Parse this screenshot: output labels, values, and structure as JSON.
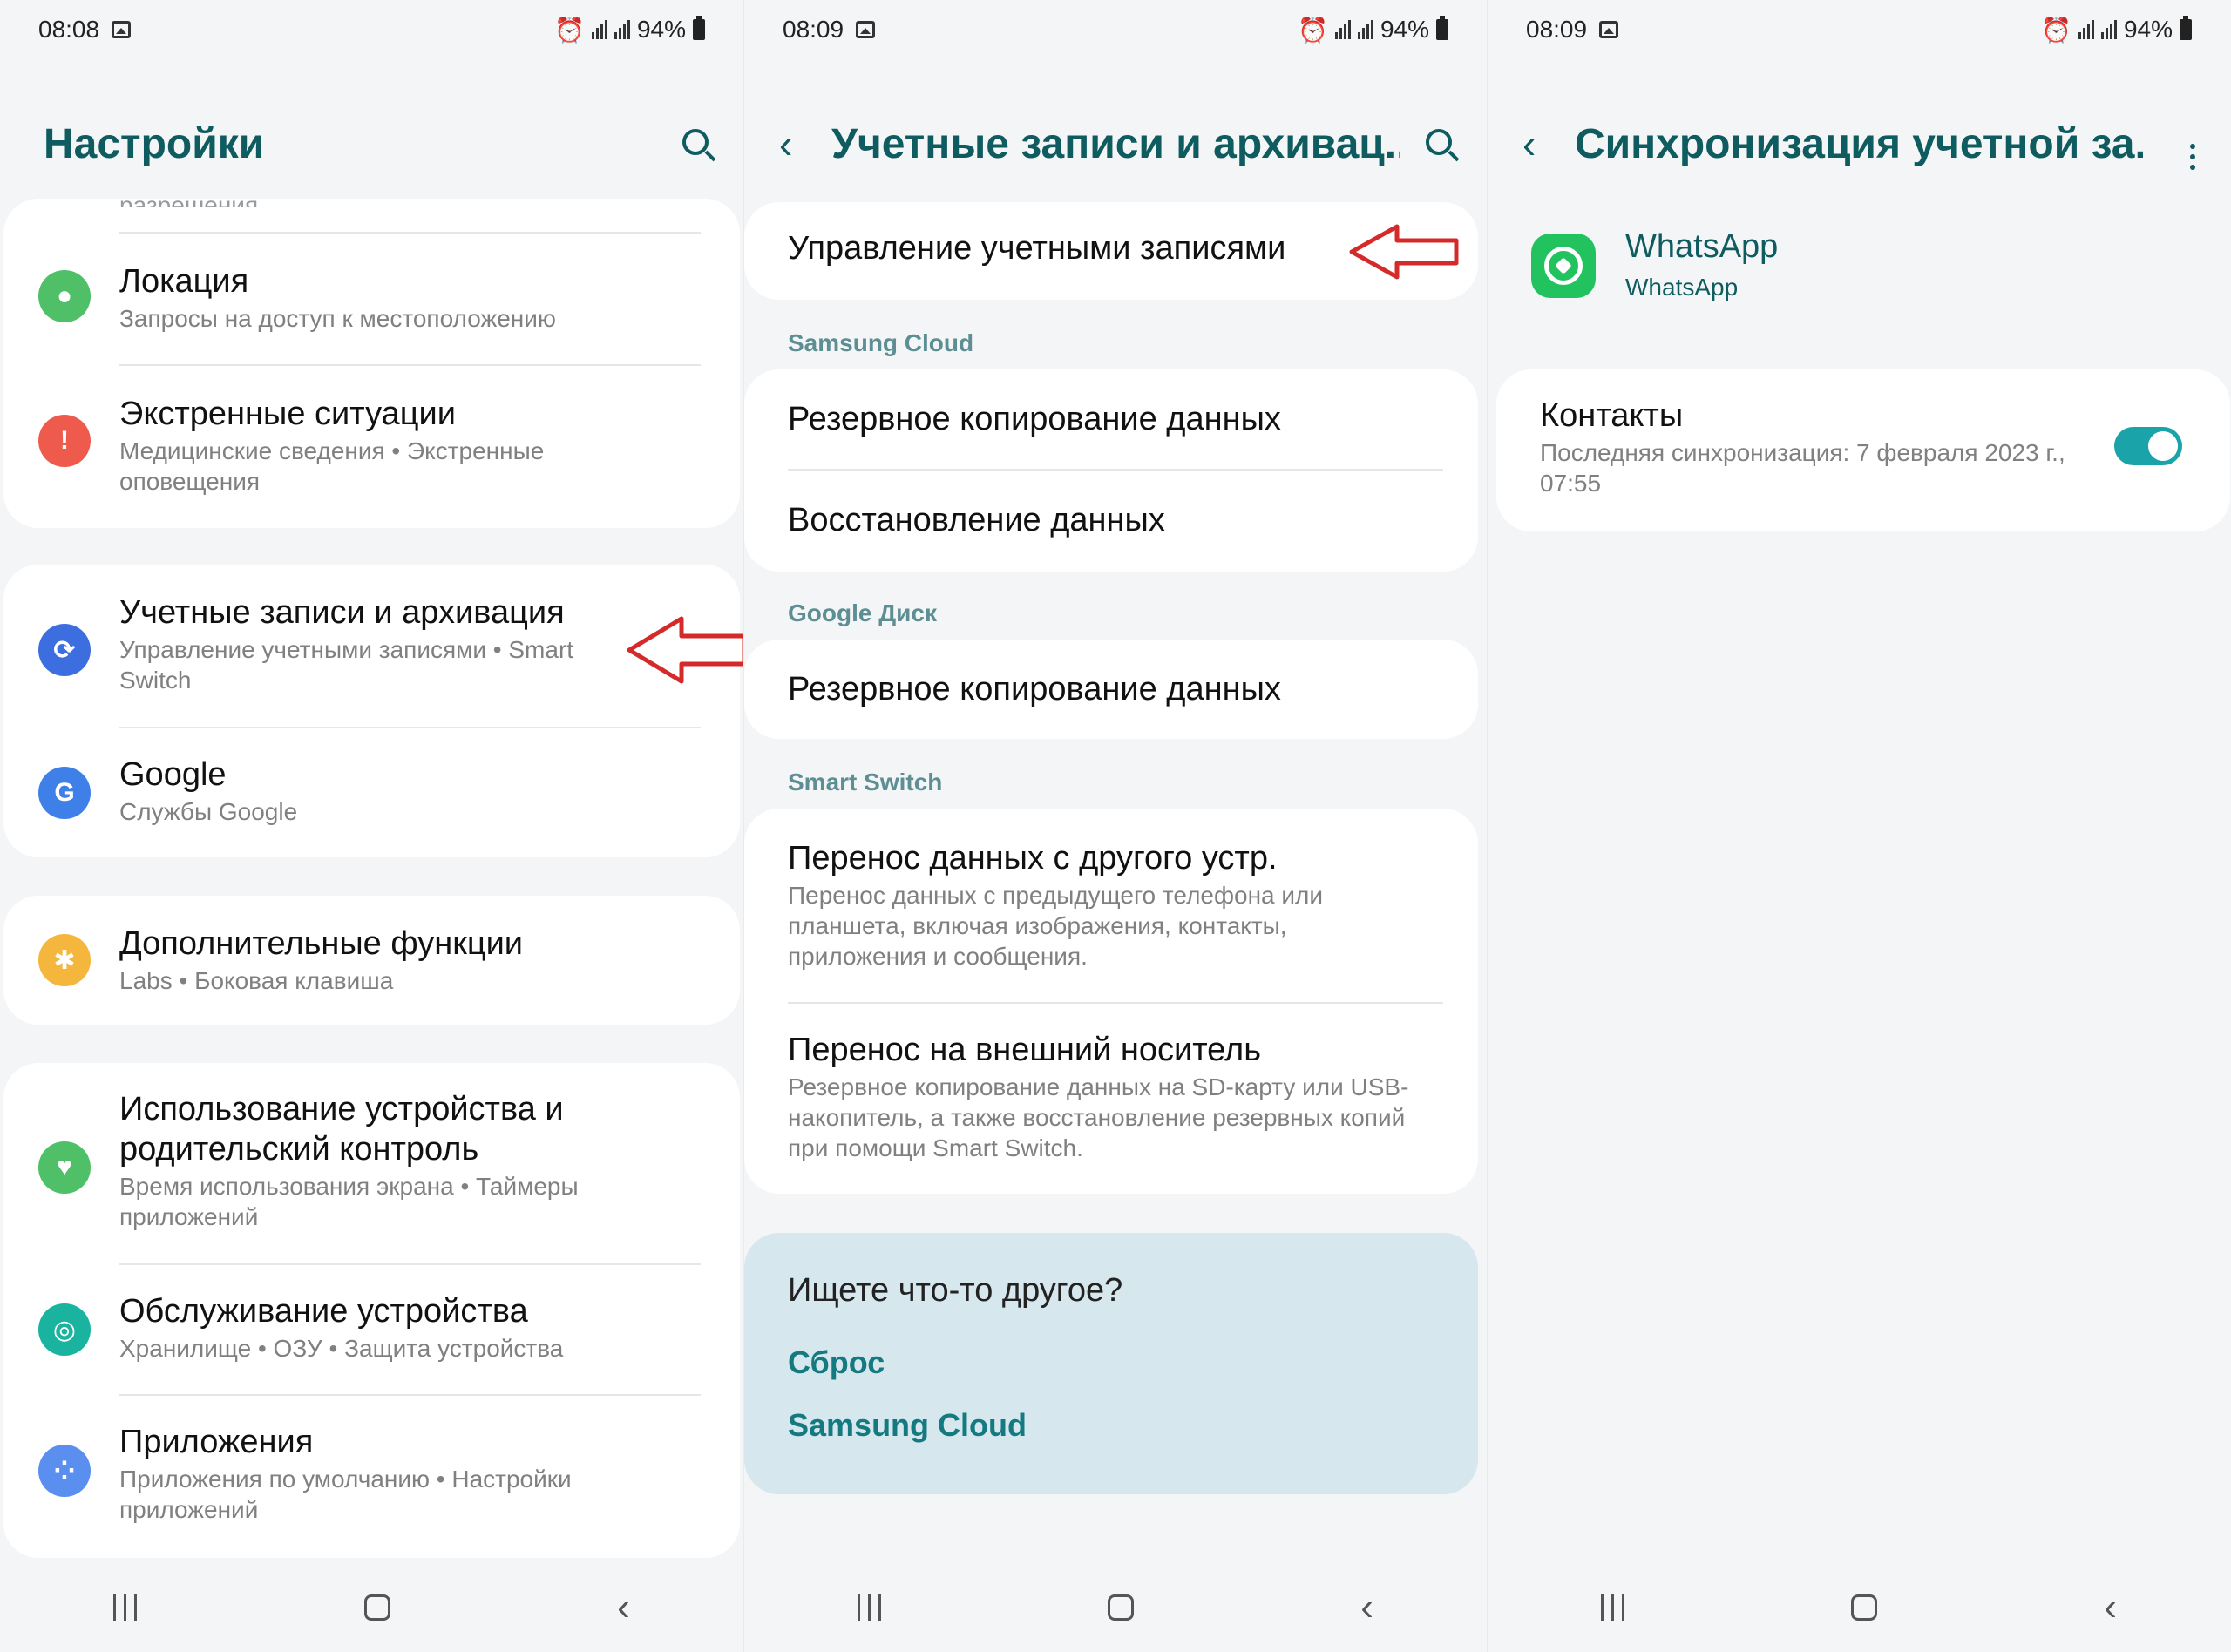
{
  "status": {
    "panel1_time": "08:08",
    "panel2_time": "08:09",
    "panel3_time": "08:09",
    "battery": "94%"
  },
  "panel1": {
    "title": "Настройки",
    "clipped_text": "разрешения",
    "items": [
      {
        "title": "Локация",
        "subtitle": "Запросы на доступ к местоположению",
        "icon": "location-pin-icon",
        "color": "#4fbf68"
      },
      {
        "title": "Экстренные ситуации",
        "subtitle": "Медицинские сведения  •  Экстренные оповещения",
        "icon": "alert-icon",
        "color": "#ee5b4c"
      },
      {
        "title": "Учетные записи и архивация",
        "subtitle": "Управление учетными записями  •  Smart Switch",
        "icon": "sync-icon",
        "color": "#3d6ee0"
      },
      {
        "title": "Google",
        "subtitle": "Службы Google",
        "icon": "google-icon",
        "color": "#3f7fe8"
      },
      {
        "title": "Дополнительные функции",
        "subtitle": "Labs  •  Боковая клавиша",
        "icon": "gear-plus-icon",
        "color": "#f4b63c"
      },
      {
        "title": "Использование устройства и родительский контроль",
        "subtitle": "Время использования экрана  •  Таймеры приложений",
        "icon": "heart-circle-icon",
        "color": "#4fbf68"
      },
      {
        "title": "Обслуживание устройства",
        "subtitle": "Хранилище  •  ОЗУ  •  Защита устройства",
        "icon": "care-icon",
        "color": "#19b3a0"
      },
      {
        "title": "Приложения",
        "subtitle": "Приложения по умолчанию  •  Настройки приложений",
        "icon": "apps-grid-icon",
        "color": "#5a8ff0"
      }
    ]
  },
  "panel2": {
    "title": "Учетные записи и архивац...",
    "manage_accounts": "Управление учетными записями",
    "section_samsung": "Samsung Cloud",
    "backup_samsung": "Резервное копирование данных",
    "restore": "Восстановление данных",
    "section_google": "Google Диск",
    "backup_google": "Резервное копирование данных",
    "section_switch": "Smart Switch",
    "transfer_title": "Перенос данных с другого устр.",
    "transfer_sub": "Перенос данных с предыдущего телефона или планшета, включая изображения, контакты, приложения и сообщения.",
    "external_title": "Перенос на внешний носитель",
    "external_sub": "Резервное копирование данных на SD-карту или USB-накопитель, а также восстановление резервных копий при помощи Smart Switch.",
    "more_question": "Ищете что-то другое?",
    "link_reset": "Сброс",
    "link_cloud": "Samsung Cloud"
  },
  "panel3": {
    "title": "Синхронизация учетной за...",
    "app_name": "WhatsApp",
    "app_account": "WhatsApp",
    "contacts_title": "Контакты",
    "contacts_sub": "Последняя синхронизация: 7 февраля 2023 г., 07:55",
    "toggle_on": true
  },
  "colors": {
    "accent": "#0e5b60",
    "link": "#157a80",
    "arrow": "#d42a2a"
  }
}
